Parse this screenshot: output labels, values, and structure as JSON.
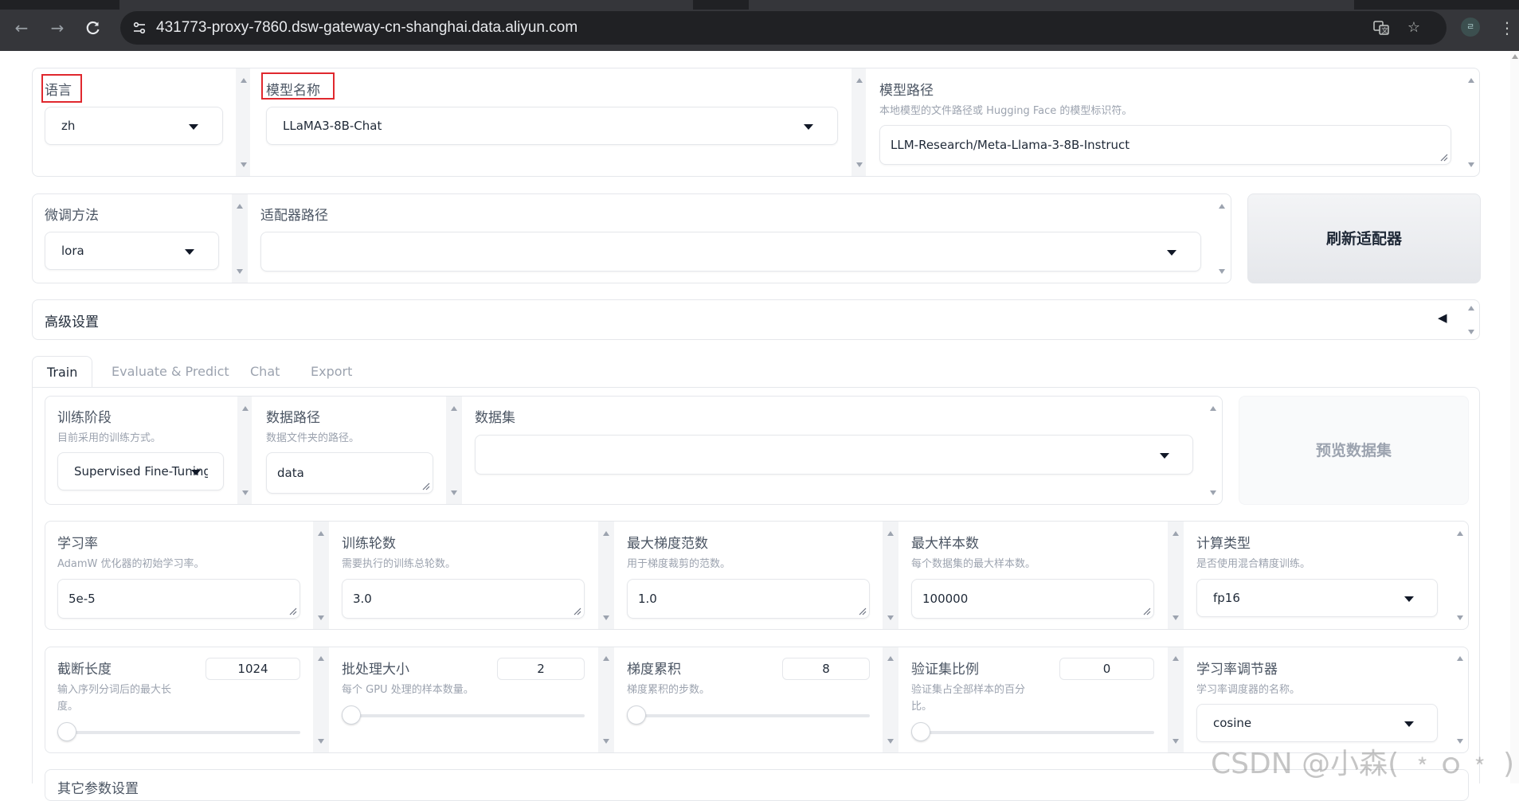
{
  "browser": {
    "url": "431773-proxy-7860.dsw-gateway-cn-shanghai.data.aliyun.com",
    "profile_initial": "ㄹ"
  },
  "top": {
    "lang": {
      "label": "语言",
      "value": "zh"
    },
    "model_name": {
      "label": "模型名称",
      "value": "LLaMA3-8B-Chat"
    },
    "model_path": {
      "label": "模型路径",
      "info": "本地模型的文件路径或 Hugging Face 的模型标识符。",
      "value": "LLM-Research/Meta-Llama-3-8B-Instruct"
    }
  },
  "second": {
    "finetune": {
      "label": "微调方法",
      "value": "lora"
    },
    "adapter": {
      "label": "适配器路径",
      "value": ""
    },
    "refresh_label": "刷新适配器"
  },
  "advanced": {
    "label": "高级设置",
    "arrow": "◀"
  },
  "tabs": [
    "Train",
    "Evaluate & Predict",
    "Chat",
    "Export"
  ],
  "train": {
    "stage": {
      "label": "训练阶段",
      "info": "目前采用的训练方式。",
      "value": "Supervised Fine-Tuning"
    },
    "data_dir": {
      "label": "数据路径",
      "info": "数据文件夹的路径。",
      "value": "data"
    },
    "dataset": {
      "label": "数据集",
      "value": ""
    },
    "preview_label": "预览数据集",
    "row1": [
      {
        "label": "学习率",
        "info": "AdamW 优化器的初始学习率。",
        "value": "5e-5"
      },
      {
        "label": "训练轮数",
        "info": "需要执行的训练总轮数。",
        "value": "3.0"
      },
      {
        "label": "最大梯度范数",
        "info": "用于梯度裁剪的范数。",
        "value": "1.0"
      },
      {
        "label": "最大样本数",
        "info": "每个数据集的最大样本数。",
        "value": "100000"
      },
      {
        "label": "计算类型",
        "info": "是否使用混合精度训练。",
        "value": "fp16"
      }
    ],
    "row2": [
      {
        "label": "截断长度",
        "info_line1": "输入序列分词后的最大长",
        "info_line2": "度。",
        "value": "1024",
        "fraction": 0.0
      },
      {
        "label": "批处理大小",
        "info_line1": "每个 GPU 处理的样本数量。",
        "info_line2": "",
        "value": "2",
        "fraction": 0.0
      },
      {
        "label": "梯度累积",
        "info_line1": "梯度累积的步数。",
        "info_line2": "",
        "value": "8",
        "fraction": 0.0
      },
      {
        "label": "验证集比例",
        "info_line1": "验证集占全部样本的百分",
        "info_line2": "比。",
        "value": "0",
        "fraction": 0.0
      },
      {
        "label": "学习率调节器",
        "info_line1": "学习率调度器的名称。",
        "info_line2": "",
        "value": "cosine"
      }
    ],
    "next_section_label": "其它参数设置"
  },
  "watermark": "CSDN @小森( ﹡ｏ﹡ )"
}
